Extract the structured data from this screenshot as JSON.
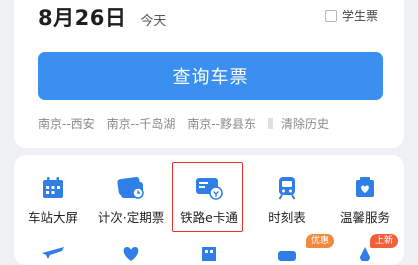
{
  "date": {
    "text": "8月26日",
    "today": "今天"
  },
  "student": {
    "label": "学生票"
  },
  "query": {
    "label": "查询车票"
  },
  "history": {
    "items": [
      "南京--西安",
      "南京--千岛湖",
      "南京--黟县东"
    ],
    "clear": "清除历史"
  },
  "services": [
    {
      "label": "车站大屏",
      "icon": "station-screen-icon"
    },
    {
      "label": "计次·定期票",
      "icon": "ticket-pass-icon"
    },
    {
      "label": "铁路e卡通",
      "icon": "rail-ecard-icon"
    },
    {
      "label": "时刻表",
      "icon": "train-timetable-icon"
    },
    {
      "label": "温馨服务",
      "icon": "heart-service-icon"
    }
  ],
  "row2_badges": {
    "b4": "优惠",
    "b5": "上新"
  },
  "colors": {
    "accent": "#3b8ff0",
    "highlight": "#e5322c",
    "badge": "#f08a3c"
  }
}
